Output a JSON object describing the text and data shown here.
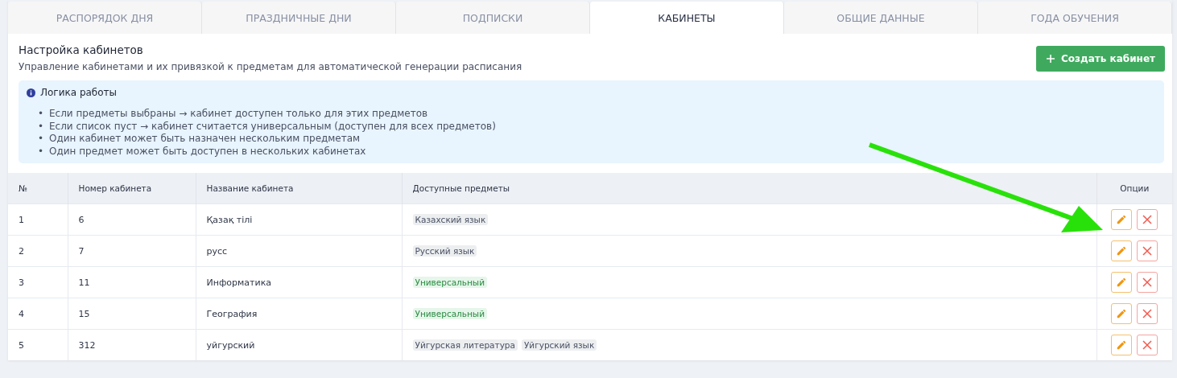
{
  "tabs": [
    {
      "label": "РАСПОРЯДОК ДНЯ",
      "selected": false
    },
    {
      "label": "ПРАЗДНИЧНЫЕ ДНИ",
      "selected": false
    },
    {
      "label": "ПОДПИСКИ",
      "selected": false
    },
    {
      "label": "КАБИНЕТЫ",
      "selected": true
    },
    {
      "label": "ОБЩИЕ ДАННЫЕ",
      "selected": false
    },
    {
      "label": "ГОДА ОБУЧЕНИЯ",
      "selected": false
    }
  ],
  "header": {
    "title": "Настройка кабинетов",
    "subtitle": "Управление кабинетами и их привязкой к предметам для автоматической генерации расписания",
    "create_button": "Создать кабинет"
  },
  "info": {
    "title": "Логика работы",
    "bullet": "•",
    "items": [
      "Если предметы выбраны → кабинет доступен только для этих предметов",
      "Если список пуст → кабинет считается универсальным (доступен для всех предметов)",
      "Один кабинет может быть назначен нескольким предметам",
      "Один предмет может быть доступен в нескольких кабинетах"
    ]
  },
  "table": {
    "columns": [
      "№",
      "Номер кабинета",
      "Название кабинета",
      "Доступные предметы",
      "Опции"
    ],
    "rows": [
      {
        "index": "1",
        "number": "6",
        "name": "Қазақ тілі",
        "subjects": [
          {
            "label": "Казахский язык",
            "kind": "subject"
          }
        ]
      },
      {
        "index": "2",
        "number": "7",
        "name": "русс",
        "subjects": [
          {
            "label": "Русский язык",
            "kind": "subject"
          }
        ]
      },
      {
        "index": "3",
        "number": "11",
        "name": "Информатика",
        "subjects": [
          {
            "label": "Универсальный",
            "kind": "universal"
          }
        ]
      },
      {
        "index": "4",
        "number": "15",
        "name": "География",
        "subjects": [
          {
            "label": "Универсальный",
            "kind": "universal"
          }
        ]
      },
      {
        "index": "5",
        "number": "312",
        "name": "уйгурский",
        "subjects": [
          {
            "label": "Уйгурская литература",
            "kind": "subject"
          },
          {
            "label": "Уйгурский язык",
            "kind": "subject"
          }
        ]
      }
    ]
  }
}
